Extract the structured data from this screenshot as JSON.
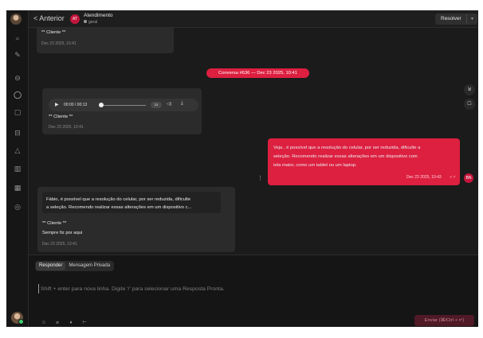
{
  "header": {
    "back_label": "< Anterior",
    "contact_initials": "AT",
    "contact_name": "Atendimento",
    "contact_inbox": "geral",
    "resolve_label": "Resolver",
    "more_label": "⋮"
  },
  "sidebar": {
    "icons": [
      "logo-icon",
      "search-icon",
      "compose-icon",
      "inbox-icon",
      "conversations-icon",
      "capture-icon",
      "reports-icon",
      "campaigns-icon",
      "library-icon",
      "settings-icon",
      "help-icon"
    ]
  },
  "messages": {
    "m1": {
      "text": "** Cliente **",
      "time": "Dec 23 2025, 10:41"
    },
    "divider": "Conversa #636 — Dec 23 2025, 10:41",
    "audio": {
      "time": "00:00 / 00:13",
      "speed": "1x"
    },
    "m2": {
      "text": "** Cliente **",
      "time": "Dec 23 2025, 10:41"
    },
    "out": {
      "line1": "Veja , é possível que a resolução do celular, por ser reduzida, dificulte a",
      "line2": "seleção. Recomendo realizar essas alterações em um dispositivo com",
      "line3": "tela maior, como um tablet ou um laptop.",
      "time": "Dec 23 2025, 10:43",
      "check": "✓✓",
      "agent_initials": "BN"
    },
    "m3": {
      "quote1": "Fábio, é possível que a resolução do celular, por ser reduzida, dificulte",
      "quote2": "a seleção. Recomendo realizar essas alterações em um dispositivo c...",
      "text": "** Cliente **",
      "text2": "Sempre fiz por aqui",
      "time": "Dec 23 2025, 13:41"
    }
  },
  "composer": {
    "tab_reply": "Responder",
    "tab_private": "Mensagem Privada",
    "placeholder": "Shift + enter para nova linha. Digite '/' para selecionar uma Resposta Pronta.",
    "send_label": "Enviar (⌘/Ctrl + ↵)"
  }
}
